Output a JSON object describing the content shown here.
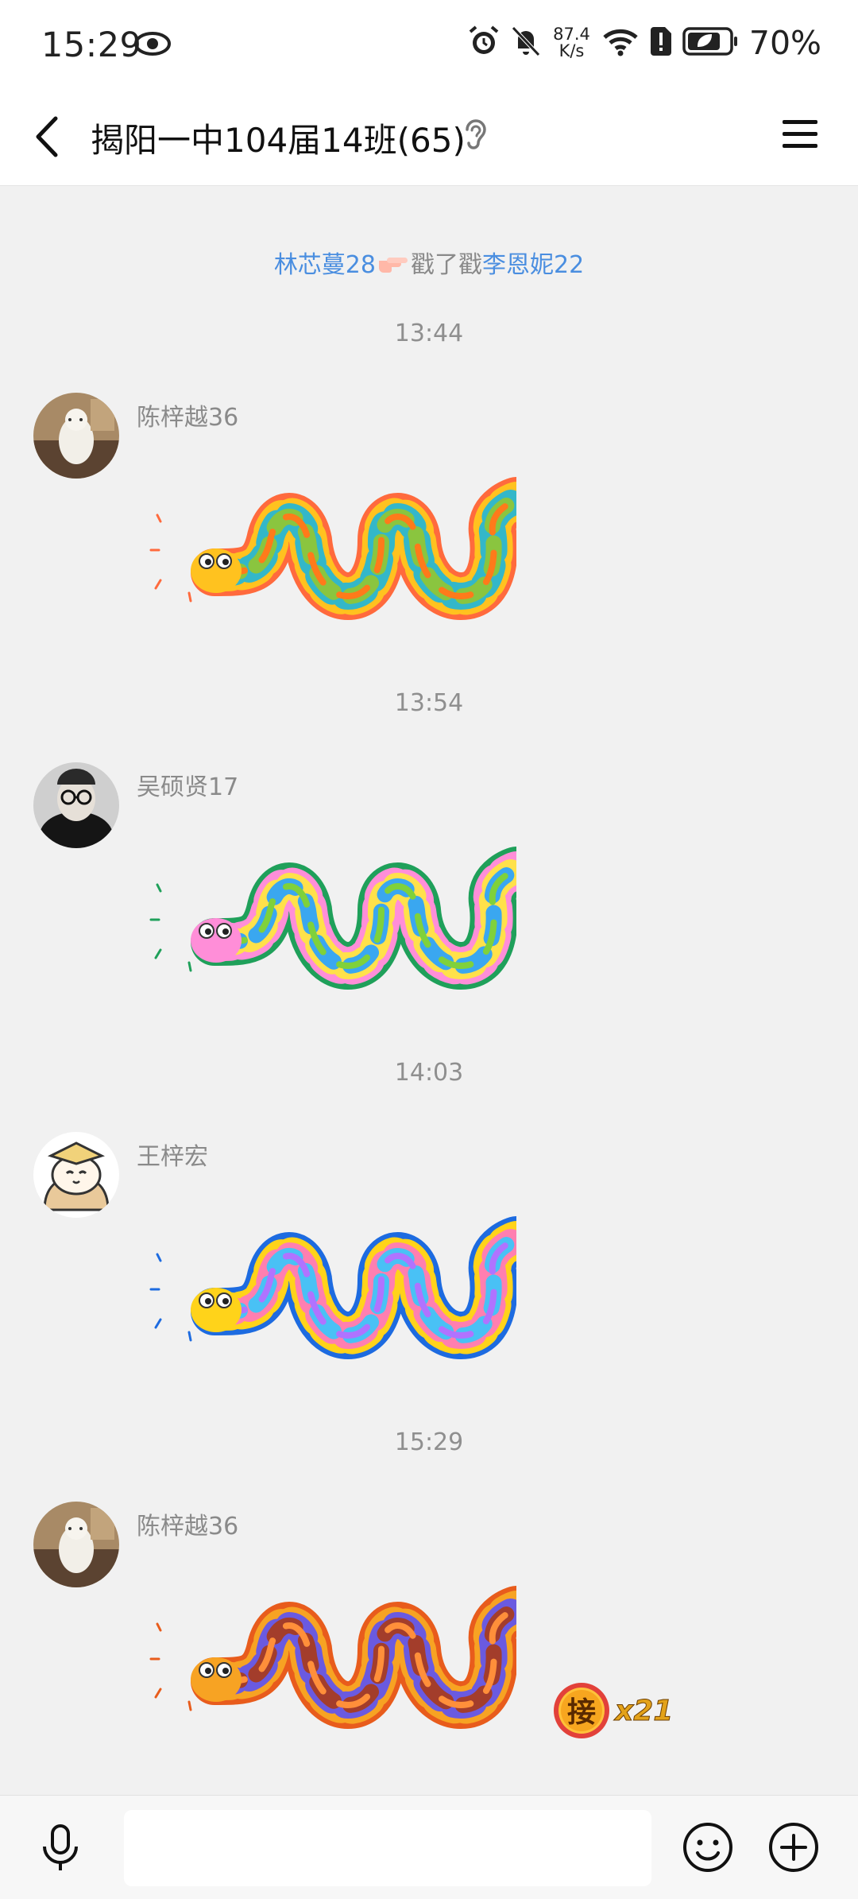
{
  "status_bar": {
    "time": "15:29",
    "net_rate_value": "87.4",
    "net_rate_unit": "K/s",
    "battery": "70%"
  },
  "header": {
    "title": "揭阳一中104届14班(65)"
  },
  "poke_notice": {
    "actor": "林芯蔓28",
    "action": "戳了戳",
    "target": "李恩妮22"
  },
  "messages": [
    {
      "time": "13:44",
      "sender": "陈梓越36",
      "sticker_palette": [
        "#ff6a3d",
        "#ffc21f",
        "#33b7c9",
        "#8ac53f",
        "#ff7a1a"
      ]
    },
    {
      "time": "13:54",
      "sender": "吴硕贤17",
      "sticker_palette": [
        "#1fa05a",
        "#ff8ed8",
        "#ffe14a",
        "#3aa7f0",
        "#7fd13b"
      ]
    },
    {
      "time": "14:03",
      "sender": "王梓宏",
      "sticker_palette": [
        "#1d6be0",
        "#ffd31a",
        "#ff7fb0",
        "#49c1f5",
        "#b073ff"
      ]
    },
    {
      "time": "15:29",
      "sender": "陈梓越36",
      "sticker_palette": [
        "#e85c1c",
        "#f7a323",
        "#6a5ae0",
        "#a33d2b",
        "#ff8f3a"
      ]
    }
  ],
  "relay_badge": {
    "char": "接",
    "count": "x21"
  },
  "colors": {
    "accent_link": "#4a8ee0",
    "background": "#f1f1f1"
  }
}
